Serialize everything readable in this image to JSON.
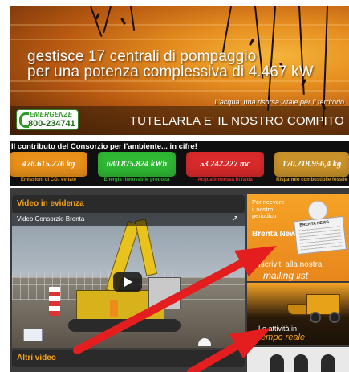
{
  "hero": {
    "headline_line1": "gestisce 17 centrali di pompaggio",
    "headline_line2": "per una potenza complessiva di 4.467 kW",
    "tagline": "L'acqua: una risorsa vitale per il territorio",
    "slogan": "TUTELARLA E' IL NOSTRO COMPITO",
    "emergency_label": "EMERGENZE",
    "emergency_number": "800-234741"
  },
  "stats": {
    "title": "Il contributo del Consorzio per l'ambiente... in cifre!",
    "items": [
      {
        "value": "476.615.276 kg",
        "label": "Emissioni di CO₂ evitate",
        "color": "#e8901a",
        "label_color": "#e8901a"
      },
      {
        "value": "680.875.824 kWh",
        "label": "Energia rinnovabile prodotta",
        "color": "#2fb833",
        "label_color": "#2fb833"
      },
      {
        "value": "53.242.227 mc",
        "label": "Acqua immessa in falda",
        "color": "#d82a2a",
        "label_color": "#e03030"
      },
      {
        "value": "170.218.956,4 kg",
        "label": "Risparmio combustibile fossile",
        "color": "#c9922a",
        "label_color": "#d8a232"
      }
    ]
  },
  "video_section": {
    "heading": "Video in evidenza",
    "video_title": "Video Consorzio Brenta",
    "more_heading": "Altri video"
  },
  "sidebar": {
    "news_promo_line1": "Per ricevere",
    "news_promo_line2": "il nostro",
    "news_promo_line3": "periodico",
    "news_brand": "Brenta News",
    "newspaper_masthead": "BRENTA NEWS",
    "mailing_line1": "Iscriviti alla nostra",
    "mailing_line2": "mailing list",
    "activity_line1": "Le attività in",
    "activity_line2": "tempo reale"
  },
  "colors": {
    "accent_orange": "#f7a21b",
    "arrow_red": "#e41e1e",
    "dark_panel": "#3b3b3b"
  }
}
